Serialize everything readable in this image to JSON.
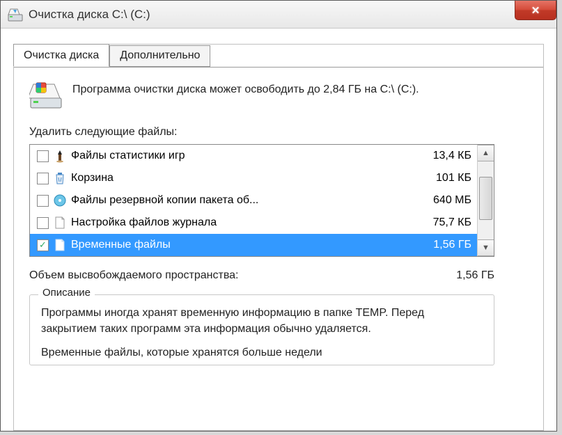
{
  "window": {
    "title": "Очистка диска C:\\ (C:)"
  },
  "tabs": {
    "cleanup": "Очистка диска",
    "more": "Дополнительно"
  },
  "intro": "Программа очистки диска может освободить до 2,84 ГБ на C:\\ (C:).",
  "delete_label": "Удалить следующие файлы:",
  "files": [
    {
      "label": "Файлы статистики игр",
      "size": "13,4 КБ",
      "checked": false
    },
    {
      "label": "Корзина",
      "size": "101 КБ",
      "checked": false
    },
    {
      "label": "Файлы резервной копии пакета об...",
      "size": "640 МБ",
      "checked": false
    },
    {
      "label": "Настройка файлов журнала",
      "size": "75,7 КБ",
      "checked": false
    },
    {
      "label": "Временные файлы",
      "size": "1,56 ГБ",
      "checked": true
    }
  ],
  "total": {
    "label": "Объем высвобождаемого пространства:",
    "value": "1,56 ГБ"
  },
  "description": {
    "legend": "Описание",
    "body": "Программы иногда хранят временную информацию в папке TEMP. Перед закрытием таких программ эта информация обычно удаляется.",
    "cutline": "Временные файлы, которые хранятся больше недели"
  }
}
